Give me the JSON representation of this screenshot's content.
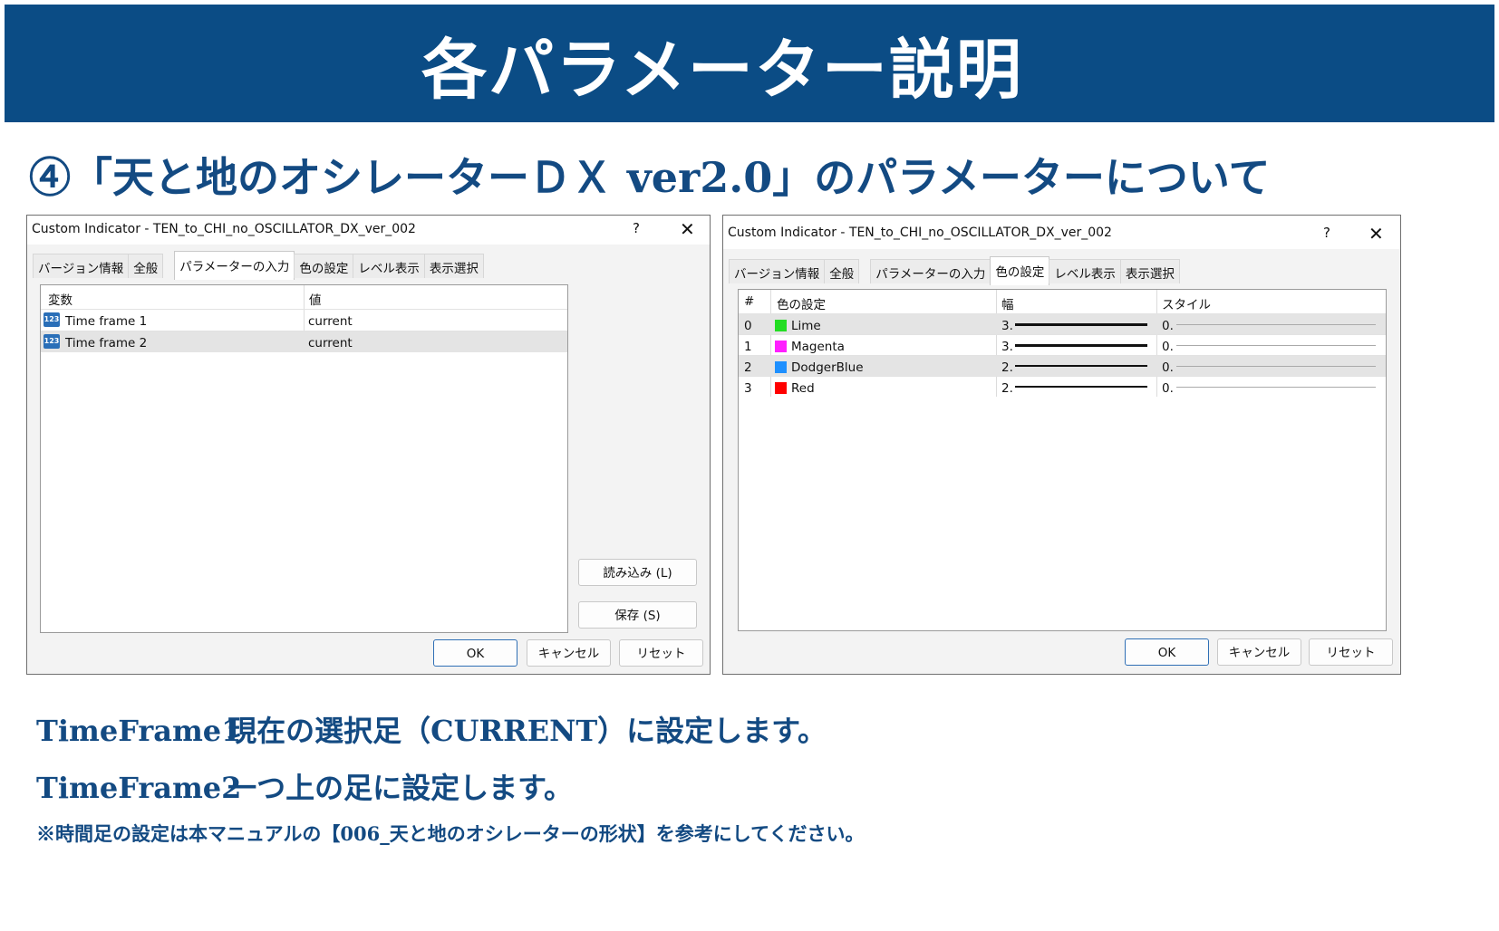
{
  "banner": {
    "title": "各パラメーター説明"
  },
  "subtitle": "④「天と地のオシレーターＤＸ ver2.0」のパラメーターについて",
  "dialog_left": {
    "title": "Custom Indicator - TEN_to_CHI_no_OSCILLATOR_DX_ver_002",
    "help": "?",
    "close": "✕",
    "tabs": [
      "バージョン情報",
      "全般",
      "パラメーターの入力",
      "色の設定",
      "レベル表示",
      "表示選択"
    ],
    "active_tab": "パラメーターの入力",
    "columns": [
      "変数",
      "値"
    ],
    "rows": [
      {
        "icon": "123",
        "name": "Time frame 1",
        "value": "current"
      },
      {
        "icon": "123",
        "name": "Time frame 2",
        "value": "current"
      }
    ],
    "load_button": "読み込み (L)",
    "save_button": "保存 (S)",
    "ok": "OK",
    "cancel": "キャンセル",
    "reset": "リセット"
  },
  "dialog_right": {
    "title": "Custom Indicator - TEN_to_CHI_no_OSCILLATOR_DX_ver_002",
    "help": "?",
    "close": "✕",
    "tabs": [
      "バージョン情報",
      "全般",
      "パラメーターの入力",
      "色の設定",
      "レベル表示",
      "表示選択"
    ],
    "active_tab": "色の設定",
    "columns": [
      "#",
      "色の設定",
      "幅",
      "スタイル"
    ],
    "rows": [
      {
        "idx": "0",
        "color_name": "Lime",
        "color": "#22dd22",
        "width": "3.",
        "style": "0."
      },
      {
        "idx": "1",
        "color_name": "Magenta",
        "color": "#ff1fff",
        "width": "3.",
        "style": "0."
      },
      {
        "idx": "2",
        "color_name": "DodgerBlue",
        "color": "#1e90ff",
        "width": "2.",
        "style": "0."
      },
      {
        "idx": "3",
        "color_name": "Red",
        "color": "#ff0000",
        "width": "2.",
        "style": "0."
      }
    ],
    "ok": "OK",
    "cancel": "キャンセル",
    "reset": "リセット"
  },
  "notes": {
    "line1_key": "TimeFrame1",
    "line1_text": "現在の選択足（CURRENT）に設定します。",
    "line2_key": "TimeFrame2",
    "line2_text": "一つ上の足に設定します。",
    "footnote": "※時間足の設定は本マニュアルの【006_天と地のオシレーターの形状】を参考にしてください。"
  },
  "colors": {
    "banner": "#0b4c85",
    "heading_text": "#134a82"
  }
}
